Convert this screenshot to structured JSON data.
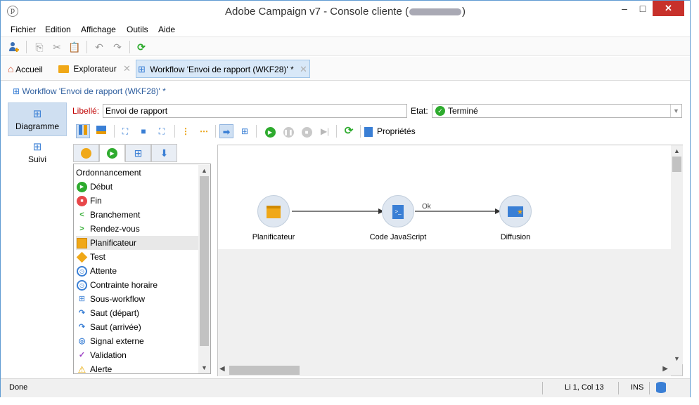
{
  "window": {
    "title_prefix": "Adobe Campaign v7 - Console cliente (",
    "title_suffix": ")",
    "minimize": "–",
    "maximize": "□",
    "close": "✕"
  },
  "menu": [
    "Fichier",
    "Edition",
    "Affichage",
    "Outils",
    "Aide"
  ],
  "tabs": {
    "home": "Accueil",
    "explorer": "Explorateur",
    "workflow": "Workflow 'Envoi de rapport (WKF28)' *"
  },
  "breadcrumb": "Workflow 'Envoi de rapport (WKF28)' *",
  "leftnav": {
    "diagram": "Diagramme",
    "tracking": "Suivi"
  },
  "form": {
    "label_caption": "Libellé:",
    "label_value": "Envoi de rapport",
    "state_caption": "Etat:",
    "state_value": "Terminé"
  },
  "toolbar2": {
    "properties": "Propriétés"
  },
  "palette": {
    "header": "Ordonnancement",
    "items": [
      {
        "label": "Début",
        "icon": "start-icon"
      },
      {
        "label": "Fin",
        "icon": "end-icon"
      },
      {
        "label": "Branchement",
        "icon": "fork-icon"
      },
      {
        "label": "Rendez-vous",
        "icon": "and-join-icon"
      },
      {
        "label": "Planificateur",
        "icon": "scheduler-icon"
      },
      {
        "label": "Test",
        "icon": "test-icon"
      },
      {
        "label": "Attente",
        "icon": "wait-icon"
      },
      {
        "label": "Contrainte horaire",
        "icon": "time-constraint-icon"
      },
      {
        "label": "Sous-workflow",
        "icon": "subworkflow-icon"
      },
      {
        "label": "Saut (départ)",
        "icon": "jump-start-icon"
      },
      {
        "label": "Saut (arrivée)",
        "icon": "jump-end-icon"
      },
      {
        "label": "Signal externe",
        "icon": "external-signal-icon"
      },
      {
        "label": "Validation",
        "icon": "validation-icon"
      },
      {
        "label": "Alerte",
        "icon": "alert-icon"
      }
    ]
  },
  "diagram": {
    "nodes": [
      {
        "label": "Planificateur",
        "icon": "calendar-icon"
      },
      {
        "label": "Code JavaScript",
        "icon": "javascript-icon"
      },
      {
        "label": "Diffusion",
        "icon": "email-delivery-icon"
      }
    ],
    "transition_label": "Ok"
  },
  "status": {
    "text": "Done",
    "position": "Li 1, Col 13",
    "mode": "INS"
  },
  "colors": {
    "accent": "#3a7fd5",
    "required_label": "#c00000",
    "success": "#2eab2e",
    "close_button": "#c7312b"
  }
}
